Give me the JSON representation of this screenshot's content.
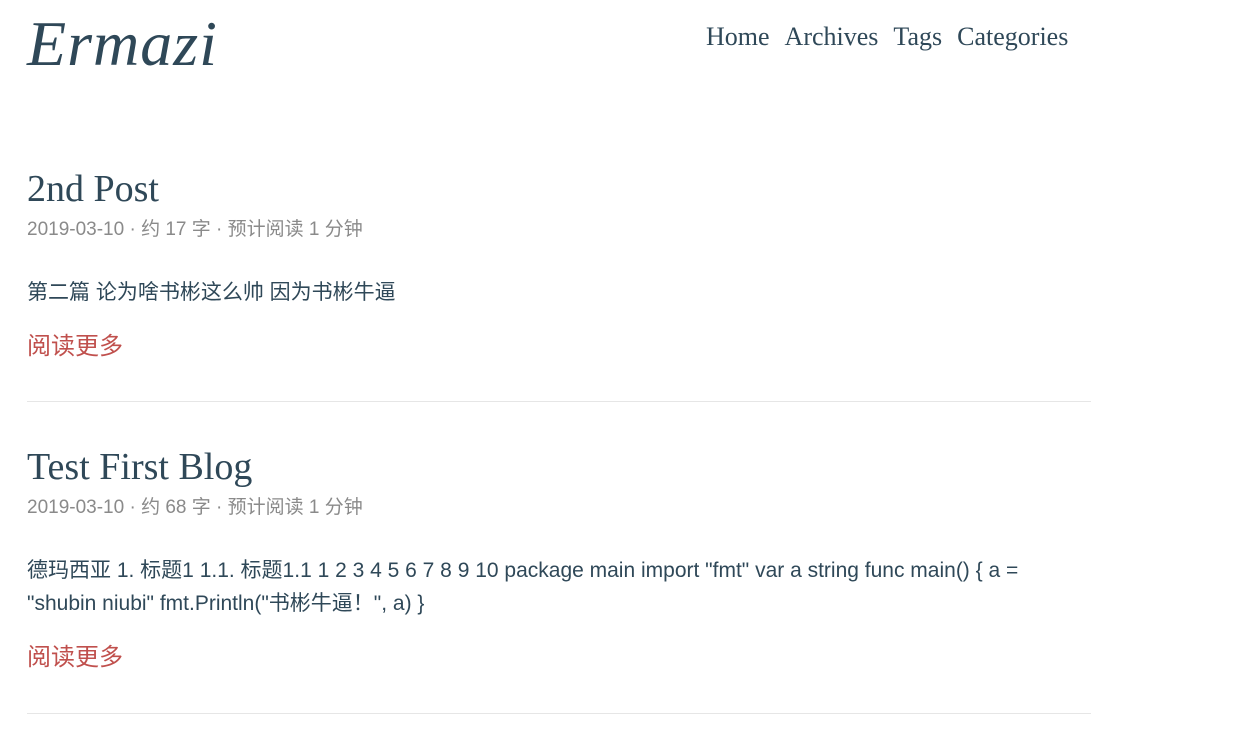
{
  "site": {
    "logo": "Ermazi"
  },
  "nav": {
    "items": [
      {
        "label": "Home"
      },
      {
        "label": "Archives"
      },
      {
        "label": "Tags"
      },
      {
        "label": "Categories"
      }
    ]
  },
  "posts": [
    {
      "title": "2nd Post",
      "meta": "2019-03-10 · 约 17 字 · 预计阅读 1 分钟",
      "excerpt": "第二篇 论为啥书彬这么帅 因为书彬牛逼",
      "read_more": "阅读更多"
    },
    {
      "title": "Test First Blog",
      "meta": "2019-03-10 · 约 68 字 · 预计阅读 1 分钟",
      "excerpt": "德玛西亚 1. 标题1 1.1. 标题1.1 1 2 3 4 5 6 7 8 9 10 package main import \"fmt\" var a string func main() { a = \"shubin niubi\" fmt.Println(\"书彬牛逼！\", a) }",
      "read_more": "阅读更多"
    }
  ],
  "colors": {
    "text": "#2f4858",
    "meta": "#8a8a8a",
    "link_accent": "#c0504d",
    "divider": "#e6e6e6"
  }
}
